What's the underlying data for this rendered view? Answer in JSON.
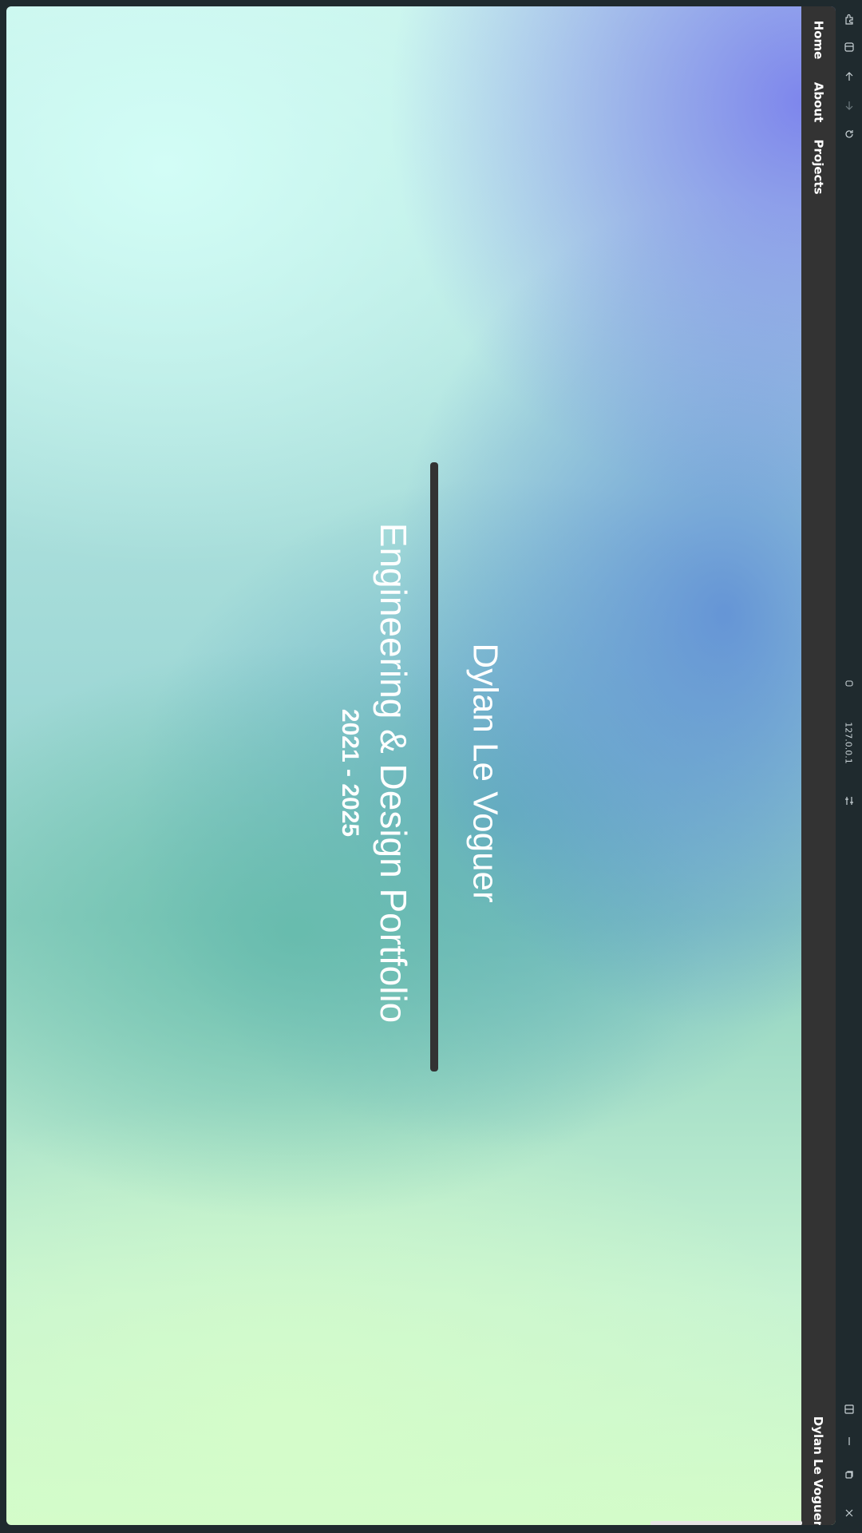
{
  "browser": {
    "url": "127.0.0.1",
    "icons": {
      "extensions": "puzzle-icon",
      "sidebar": "sidebar-icon",
      "back": "arrow-up-icon",
      "forward": "arrow-down-icon",
      "reload": "reload-icon",
      "site_info": "site-info-icon",
      "settings": "tune-icon",
      "split": "split-icon",
      "minimize": "minimize-icon",
      "restore": "restore-icon",
      "close": "close-icon"
    }
  },
  "nav": {
    "items": [
      {
        "label": "Home"
      },
      {
        "label": "About"
      },
      {
        "label": "Projects"
      }
    ],
    "site_name": "Dylan Le Voguer"
  },
  "hero": {
    "title": "Dylan Le Voguer",
    "subtitle": "Engineering & Design Portfolio",
    "years": "2021 - 2025"
  },
  "colors": {
    "nav_bg": "#333333",
    "divider": "#333333",
    "text": "#ffffff"
  }
}
